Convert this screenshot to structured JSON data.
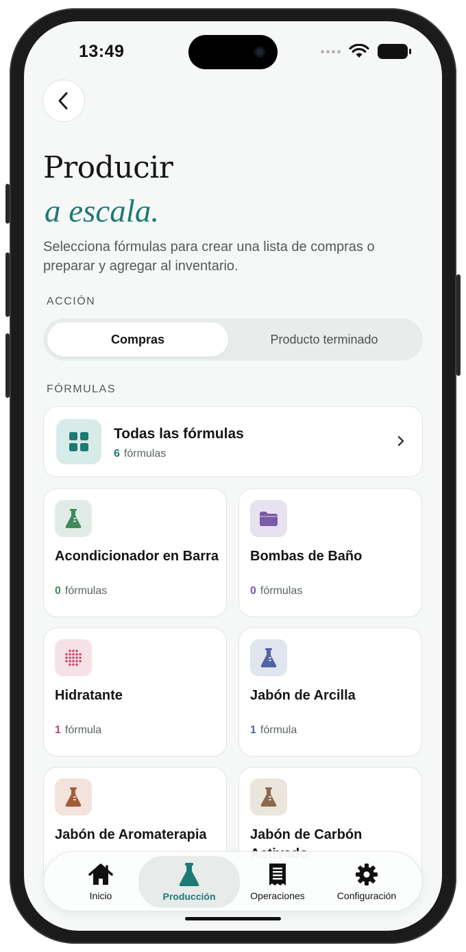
{
  "status_bar": {
    "time": "13:49"
  },
  "header": {
    "title": "Producir",
    "subtitle": "a escala.",
    "description": "Selecciona fórmulas para crear una lista de compras o preparar y agregar al inventario."
  },
  "action": {
    "label": "ACCIÓN",
    "options": [
      "Compras",
      "Producto terminado"
    ],
    "selected": "Compras"
  },
  "formulas": {
    "label": "FÓRMULAS",
    "all": {
      "name": "Todas las fórmulas",
      "count": "6",
      "unit": "fórmulas",
      "color": "#1d7b74"
    },
    "categories": [
      {
        "name": "Acondicionador en Barra",
        "count": "0",
        "unit": "fórmulas",
        "icon": "flask-icon",
        "color": "#3f8a5c",
        "bg": "#e1ece6"
      },
      {
        "name": "Bombas de Baño",
        "count": "0",
        "unit": "fórmulas",
        "icon": "folder-icon",
        "color": "#7a5ba8",
        "bg": "#e7e2ef"
      },
      {
        "name": "Hidratante",
        "count": "1",
        "unit": "fórmula",
        "icon": "dots-icon",
        "color": "#c8426a",
        "bg": "#f5e2e7"
      },
      {
        "name": "Jabón de Arcilla",
        "count": "1",
        "unit": "fórmula",
        "icon": "flask-icon",
        "color": "#4f65a6",
        "bg": "#e1e5ef"
      },
      {
        "name": "Jabón de Aromaterapia",
        "count": "",
        "unit": "",
        "icon": "flask-icon",
        "color": "#a55a3a",
        "bg": "#f2e3dc"
      },
      {
        "name": "Jabón de Carbón Activado",
        "count": "",
        "unit": "",
        "icon": "flask-icon",
        "color": "#8a6b4e",
        "bg": "#ece5dc"
      }
    ]
  },
  "tabbar": {
    "items": [
      {
        "label": "Inicio",
        "icon": "home-icon"
      },
      {
        "label": "Producción",
        "icon": "flask-icon",
        "active": true
      },
      {
        "label": "Operaciones",
        "icon": "receipt-icon"
      },
      {
        "label": "Configuración",
        "icon": "gear-icon"
      }
    ]
  },
  "colors": {
    "accent": "#1d7b74",
    "background": "#f6f8f7"
  }
}
